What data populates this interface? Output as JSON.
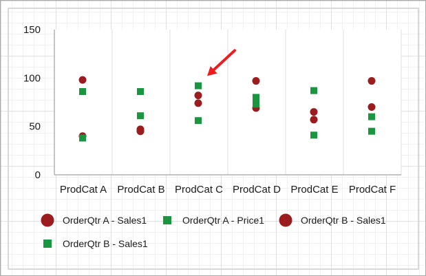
{
  "chart_data": {
    "type": "scatter",
    "title": "",
    "xlabel": "",
    "ylabel": "",
    "ylim": [
      0,
      150
    ],
    "yticks": [
      0,
      50,
      100,
      150
    ],
    "categories": [
      "ProdCat A",
      "ProdCat B",
      "ProdCat C",
      "ProdCat D",
      "ProdCat E",
      "ProdCat F"
    ],
    "grid": "vertical category gridlines",
    "legend_position": "bottom",
    "series": [
      {
        "name": "OrderQtr A - Sales1",
        "marker": "circle",
        "color": "#9b1c1f",
        "values": [
          40,
          47,
          82,
          69,
          65,
          70
        ]
      },
      {
        "name": "OrderQtr A - Price1",
        "marker": "square",
        "color": "#1a9641",
        "values": [
          38,
          61,
          56,
          73,
          87,
          60
        ]
      },
      {
        "name": "OrderQtr B - Sales1",
        "marker": "circle",
        "color": "#9b1c1f",
        "values": [
          98,
          45,
          74,
          97,
          57,
          97
        ]
      },
      {
        "name": "OrderQtr B - Sales1",
        "marker": "square",
        "color": "#1a9641",
        "values": [
          86,
          86,
          92,
          80,
          41,
          45
        ]
      }
    ],
    "annotation": {
      "type": "arrow",
      "color": "#ee1c1c",
      "points_to": {
        "category": "ProdCat C",
        "value": 100
      }
    }
  }
}
